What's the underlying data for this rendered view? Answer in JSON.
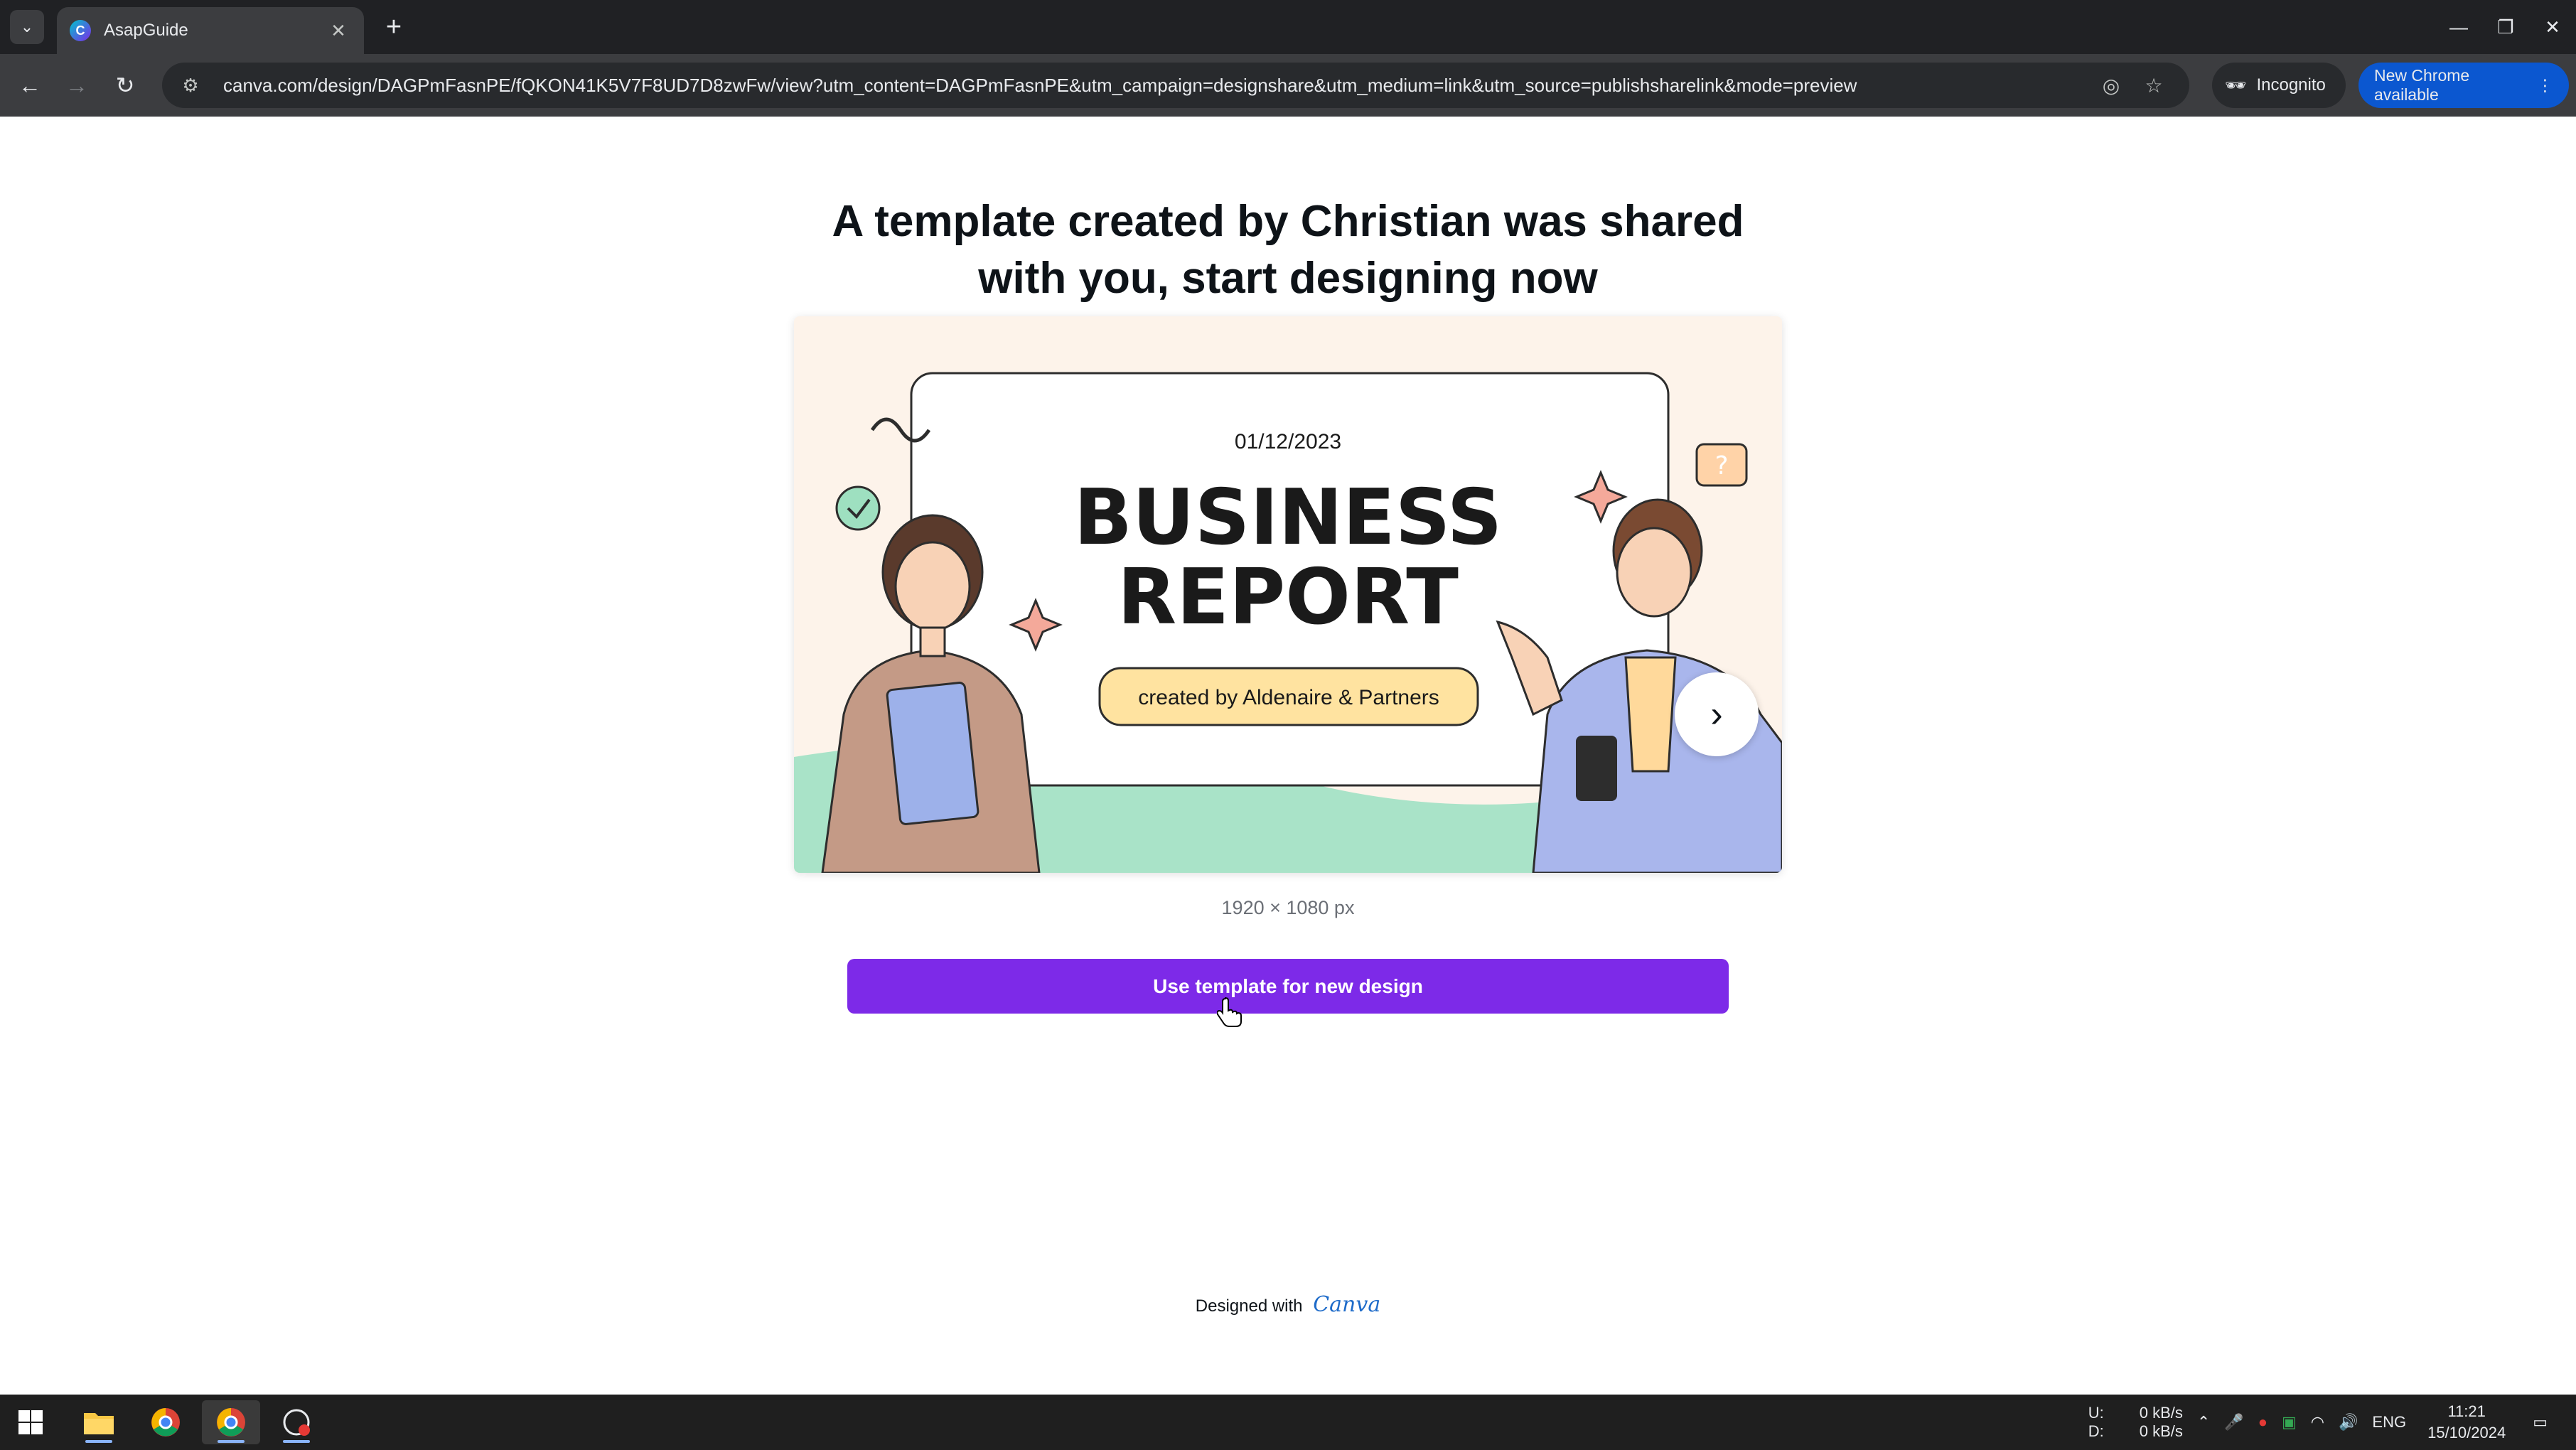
{
  "browser": {
    "tab_title": "AsapGuide",
    "url": "canva.com/design/DAGPmFasnPE/fQKON41K5V7F8UD7D8zwFw/view?utm_content=DAGPmFasnPE&utm_campaign=designshare&utm_medium=link&utm_source=publishsharelink&mode=preview",
    "incognito_label": "Incognito",
    "update_label": "New Chrome available"
  },
  "page": {
    "heading_line1": "A template created by Christian was shared",
    "heading_line2": "with you, start designing now",
    "preview": {
      "date": "01/12/2023",
      "title_line1": "BUSINESS",
      "title_line2": "REPORT",
      "subtitle": "created by Aldenaire & Partners"
    },
    "dimensions": "1920 × 1080 px",
    "cta_label": "Use template for new design",
    "footer_prefix": "Designed with",
    "footer_brand": "Canva"
  },
  "taskbar": {
    "net_up_label": "U:",
    "net_down_label": "D:",
    "net_up": "0 kB/s",
    "net_down": "0 kB/s",
    "lang": "ENG",
    "time": "11:21",
    "date": "15/10/2024"
  },
  "colors": {
    "accent": "#7d2ae8",
    "chrome_dark": "#202124",
    "update_blue": "#0b57d0"
  }
}
